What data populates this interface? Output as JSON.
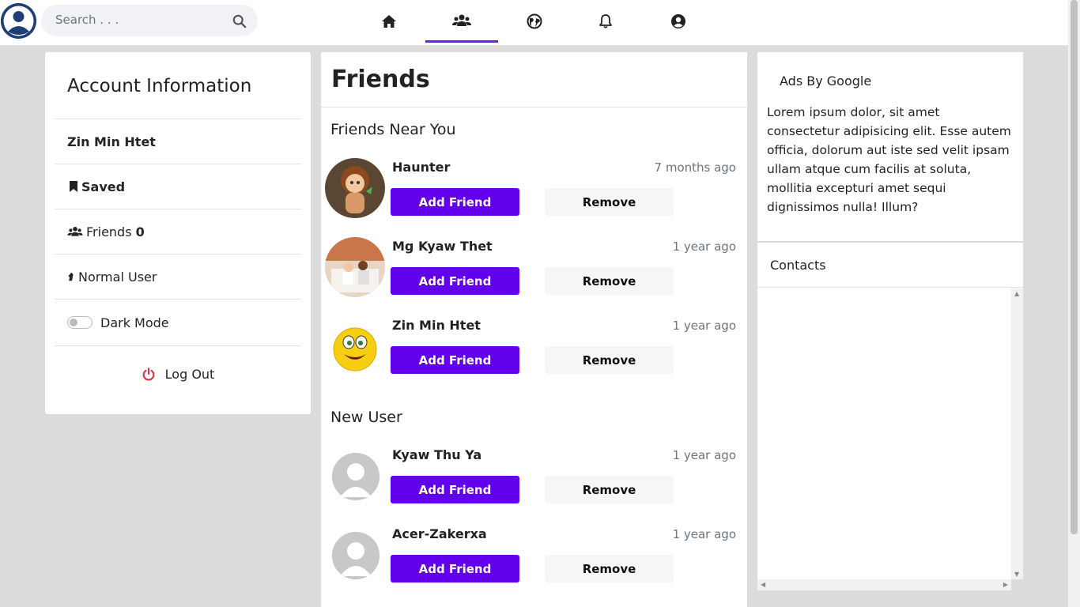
{
  "search": {
    "placeholder": "Search . . ."
  },
  "nav": {
    "items": [
      {
        "icon": "home-icon"
      },
      {
        "icon": "friends-icon",
        "active": true
      },
      {
        "icon": "globe-icon"
      },
      {
        "icon": "bell-icon"
      },
      {
        "icon": "user-circle-icon"
      }
    ]
  },
  "account": {
    "title": "Account Information",
    "username": "Zin Min Htet",
    "saved_label": "Saved",
    "friends_label": "Friends",
    "friends_count": "0",
    "user_type": "Normal User",
    "dark_mode_label": "Dark Mode",
    "logout_label": "Log Out"
  },
  "friends": {
    "title": "Friends",
    "near_title": "Friends Near You",
    "near": [
      {
        "name": "Haunter",
        "time": "7 months ago"
      },
      {
        "name": "Mg Kyaw Thet",
        "time": "1 year ago"
      },
      {
        "name": "Zin Min Htet",
        "time": "1 year ago"
      }
    ],
    "new_title": "New User",
    "new": [
      {
        "name": "Kyaw Thu Ya",
        "time": "1 year ago"
      },
      {
        "name": "Acer-Zakerxa",
        "time": "1 year ago"
      }
    ],
    "add_label": "Add Friend",
    "remove_label": "Remove"
  },
  "ads": {
    "title": "Ads By Google",
    "body": "Lorem ipsum dolor, sit amet consectetur adipisicing elit. Esse autem officia, dolorum aut iste sed velit ipsam ullam atque cum facilis at soluta, mollitia excepturi amet sequi dignissimos nulla! Illum?"
  },
  "contacts": {
    "title": "Contacts"
  },
  "colors": {
    "accent": "#6200ee",
    "nav_active": "#6a1fe8",
    "logout": "#dc3545"
  }
}
